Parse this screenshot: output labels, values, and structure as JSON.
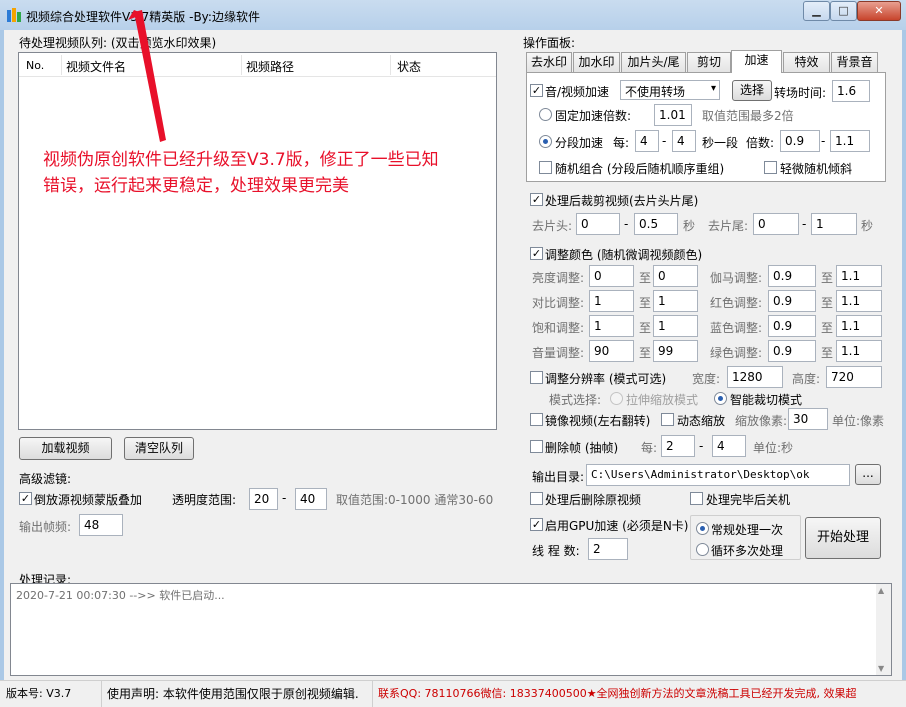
{
  "window": {
    "title": "视频综合处理软件V3.7精英版 -By:边缘软件",
    "min": "▁",
    "max": "□",
    "close": "✕"
  },
  "queue": {
    "label": "待处理视频队列: (双击预览水印效果)",
    "columns": [
      "No.",
      "视频文件名",
      "视频路径",
      "状态"
    ],
    "load_button": "加载视频",
    "clear_button": "清空队列"
  },
  "annotation": {
    "text": "视频伪原创软件已经升级至V3.7版，修正了一些已知错误，运行起来更稳定，处理效果更完美"
  },
  "filters": {
    "label": "高级滤镜:",
    "mask_overlay": "倒放源视频蒙版叠加",
    "opacity_label": "透明度范围:",
    "opacity_min": "20",
    "dash": "-",
    "opacity_max": "40",
    "range_hint": "取值范围:0-1000 通常30-60",
    "fps_label": "输出帧频:",
    "fps_value": "48"
  },
  "panel": {
    "label": "操作面板:",
    "tabs": [
      "去水印",
      "加水印",
      "加片头/尾",
      "剪切",
      "加速",
      "特效",
      "背景音"
    ]
  },
  "speed": {
    "enable": "音/视频加速",
    "transition": "不使用转场",
    "choose_button": "选择",
    "transition_time_label": "转场时间:",
    "transition_time": "1.6",
    "fixed_label": "固定加速倍数:",
    "fixed_value": "1.01",
    "fixed_hint": "取值范围最多2倍",
    "seg_label": "分段加速",
    "per_label": "每:",
    "seg_min": "4",
    "seg_max": "4",
    "sec_label": "秒一段",
    "rate_label": "倍数:",
    "rate_min": "0.9",
    "rate_max": "1.1",
    "random_combo": "随机组合 (分段后随机顺序重组)",
    "slight_tilt": "轻微随机倾斜"
  },
  "trim": {
    "enable": "处理后裁剪视频(去片头片尾)",
    "head_label": "去片头:",
    "head_min": "0",
    "head_max": "0.5",
    "sec": "秒",
    "tail_label": "去片尾:",
    "tail_min": "0",
    "tail_max": "1"
  },
  "color": {
    "enable": "调整颜色 (随机微调视频颜色)",
    "to": "至",
    "rows_left": [
      {
        "label": "亮度调整:",
        "min": "0",
        "max": "0"
      },
      {
        "label": "对比调整:",
        "min": "1",
        "max": "1"
      },
      {
        "label": "饱和调整:",
        "min": "1",
        "max": "1"
      },
      {
        "label": "音量调整:",
        "min": "90",
        "max": "99"
      }
    ],
    "rows_right": [
      {
        "label": "伽马调整:",
        "min": "0.9",
        "max": "1.1"
      },
      {
        "label": "红色调整:",
        "min": "0.9",
        "max": "1.1"
      },
      {
        "label": "蓝色调整:",
        "min": "0.9",
        "max": "1.1"
      },
      {
        "label": "绿色调整:",
        "min": "0.9",
        "max": "1.1"
      }
    ]
  },
  "resolution": {
    "enable": "调整分辨率 (模式可选)",
    "width_label": "宽度:",
    "width": "1280",
    "height_label": "高度:",
    "height": "720",
    "mode_label": "模式选择:",
    "stretch": "拉伸缩放模式",
    "smart_crop": "智能裁切模式"
  },
  "mirror": {
    "enable": "镜像视频(左右翻转)",
    "dynamic": "动态缩放",
    "zoom_label": "缩放像素:",
    "zoom": "30",
    "unit": "单位:像素"
  },
  "dropframe": {
    "enable": "删除帧 (抽帧)",
    "per_label": "每:",
    "min": "2",
    "max": "4",
    "unit": "单位:秒"
  },
  "output": {
    "dir_label": "输出目录:",
    "dir": "C:\\Users\\Administrator\\Desktop\\ok",
    "browse": "...",
    "delete_src": "处理后删除原视频",
    "shutdown": "处理完毕后关机",
    "gpu": "启用GPU加速 (必须是N卡)",
    "threads_label": "线 程 数:",
    "threads": "2",
    "once": "常规处理一次",
    "loop": "循环多次处理",
    "start": "开始处理"
  },
  "log": {
    "label": "处理记录:",
    "entry": "2020-7-21 00:07:30 -->> 软件已启动..."
  },
  "status": {
    "version": "版本号: V3.7",
    "notice": "使用声明: 本软件使用范围仅限于原创视频编辑.",
    "contact": "联系QQ: 78110766微信: 18337400500★全网独创新方法的文章洗稿工具已经开发完成, 效果超"
  },
  "colors": {
    "title_bg": "#b7d0ea",
    "accent_red": "#e8102a",
    "marquee_red": "#cc0000"
  }
}
